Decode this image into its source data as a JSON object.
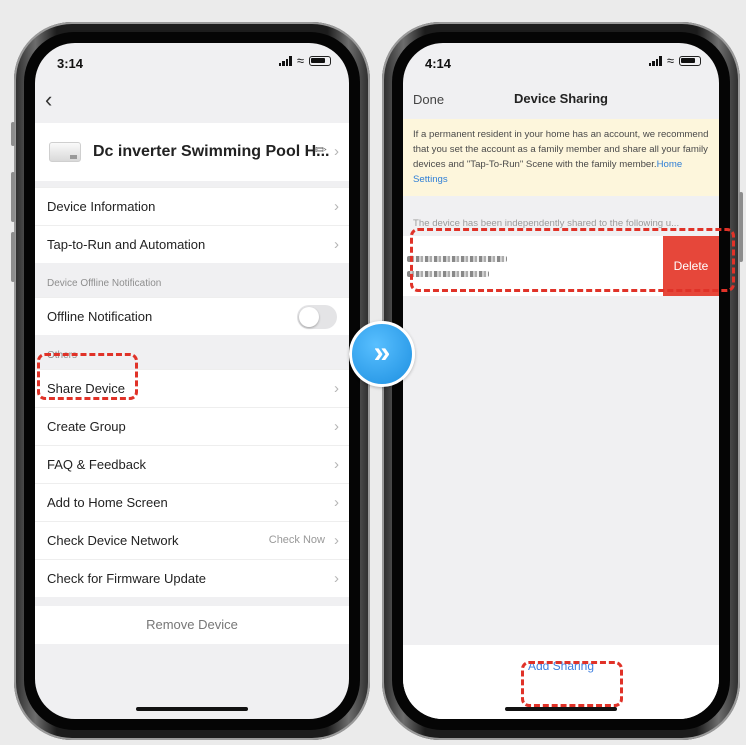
{
  "left": {
    "time": "3:14",
    "device_name": "Dc inverter Swimming Pool H...",
    "items": [
      {
        "label": "Device Information"
      },
      {
        "label": "Tap-to-Run and Automation"
      }
    ],
    "section_offline": "Device Offline Notification",
    "offline_label": "Offline Notification",
    "offline_enabled": false,
    "section_others": "Others",
    "others": [
      {
        "label": "Share Device"
      },
      {
        "label": "Create Group"
      },
      {
        "label": "FAQ & Feedback"
      },
      {
        "label": "Add to Home Screen"
      },
      {
        "label": "Check Device Network",
        "side": "Check Now"
      },
      {
        "label": "Check for Firmware Update"
      }
    ],
    "remove_label": "Remove Device"
  },
  "right": {
    "time": "4:14",
    "done_label": "Done",
    "title": "Device Sharing",
    "notice_text": "If a permanent resident in your home has an account, we recommend that you set the account as a family member and share all your family devices and \"Tap-To-Run\" Scene with the family member.",
    "notice_link": "Home Settings",
    "shared_note": "The device has been independently shared to the following u...",
    "delete_label": "Delete",
    "add_sharing_label": "Add Sharing"
  },
  "colors": {
    "highlight": "#e03228",
    "delete": "#e6473a",
    "link": "#3d7fe0",
    "notice_bg": "#fdf6dc"
  },
  "icons": {
    "arrow": "double-chevron-right-icon",
    "back": "chevron-left-icon",
    "edit": "pencil-icon"
  }
}
